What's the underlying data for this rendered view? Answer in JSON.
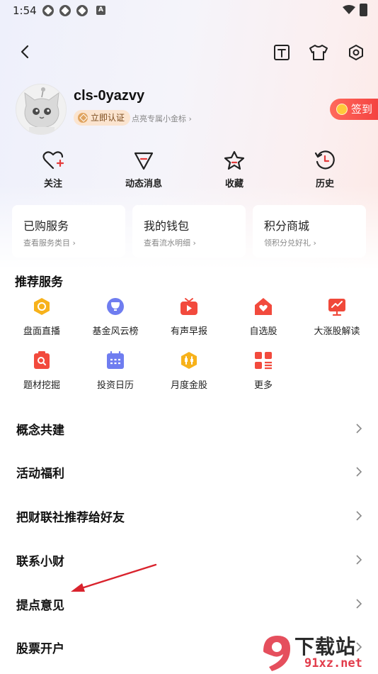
{
  "status_bar": {
    "time": "1:54",
    "notif_letter": "A"
  },
  "profile": {
    "username": "cls-0yazvy",
    "verify_label": "立即认证",
    "coin_hint": "点亮专属小金标 ›",
    "checkin_label": "签到"
  },
  "quick_actions": [
    {
      "label": "关注",
      "icon": "heart-plus-icon"
    },
    {
      "label": "动态消息",
      "icon": "message-icon"
    },
    {
      "label": "收藏",
      "icon": "star-icon"
    },
    {
      "label": "历史",
      "icon": "clock-history-icon"
    }
  ],
  "cards": [
    {
      "title": "已购服务",
      "sub": "查看服务类目 ›"
    },
    {
      "title": "我的钱包",
      "sub": "查看流水明细 ›"
    },
    {
      "title": "积分商城",
      "sub": "领积分兑好礼 ›"
    }
  ],
  "services": {
    "title": "推荐服务",
    "items": [
      {
        "label": "盘面直播",
        "icon": "live-disk-icon",
        "color": "#f7b21b"
      },
      {
        "label": "基金风云榜",
        "icon": "trophy-icon",
        "color": "#6f7df0"
      },
      {
        "label": "有声早报",
        "icon": "tv-play-icon",
        "color": "#f24a3d"
      },
      {
        "label": "自选股",
        "icon": "house-heart-icon",
        "color": "#f24a3d"
      },
      {
        "label": "大涨股解读",
        "icon": "chart-board-icon",
        "color": "#f0493a"
      },
      {
        "label": "题材挖掘",
        "icon": "clipboard-search-icon",
        "color": "#f24a3d"
      },
      {
        "label": "投资日历",
        "icon": "calendar-icon",
        "color": "#6f7df0"
      },
      {
        "label": "月度金股",
        "icon": "gold-hexagon-icon",
        "color": "#f7b21b"
      },
      {
        "label": "更多",
        "icon": "grid-more-icon",
        "color": "#f24a3d"
      }
    ]
  },
  "menu": [
    "概念共建",
    "活动福利",
    "把财联社推荐给好友",
    "联系小财",
    "提点意见",
    "股票开户"
  ],
  "watermark": {
    "brand": "下载站",
    "url": "91xz.net"
  }
}
